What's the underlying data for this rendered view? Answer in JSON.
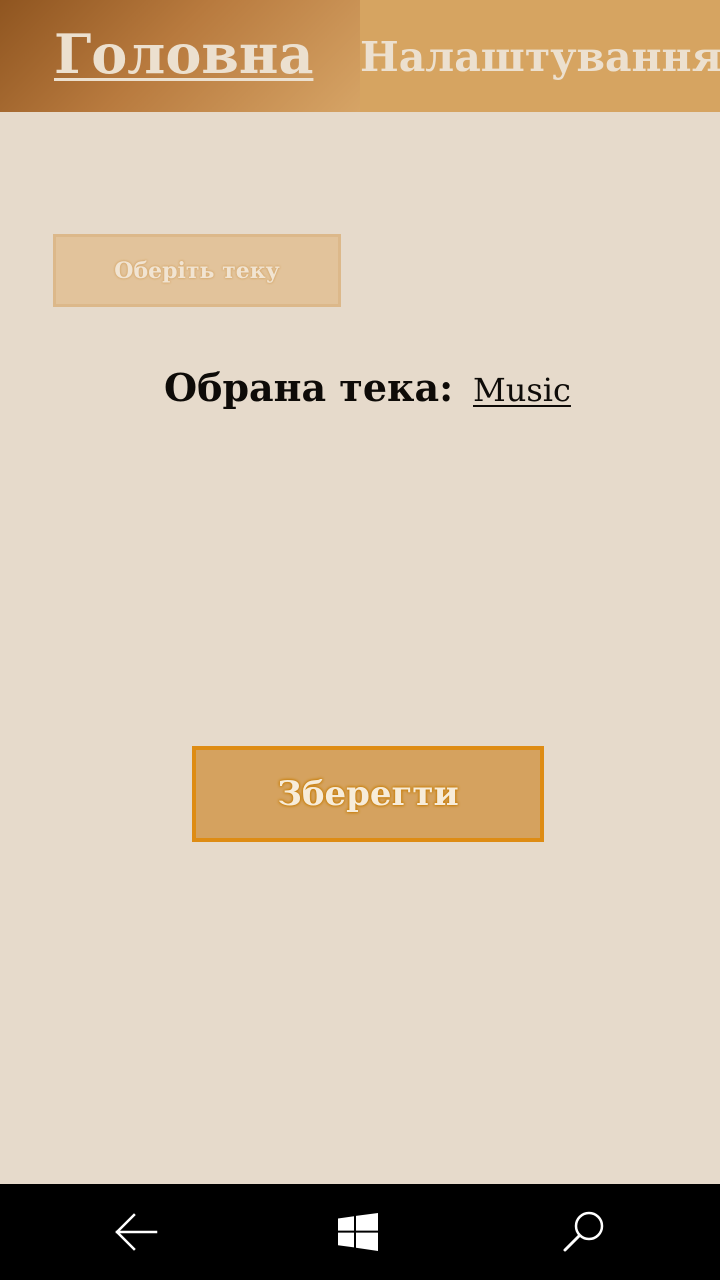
{
  "tabs": {
    "home_label": "Головна",
    "settings_label": "Налаштування"
  },
  "main": {
    "choose_folder_label": "Оберіть теку",
    "selected_folder_label": "Обрана тека:",
    "selected_folder_value": "Music",
    "save_label": "Зберегти"
  },
  "navbar": {
    "icons": [
      "back-arrow-icon",
      "windows-icon",
      "search-icon"
    ]
  },
  "colors": {
    "background": "#e6dacb",
    "tab_active_dark": "#8f5520",
    "tab_inactive": "#d6a461",
    "save_button": "#d5a25f",
    "save_border": "#de8c14",
    "navbar": "#000000"
  }
}
